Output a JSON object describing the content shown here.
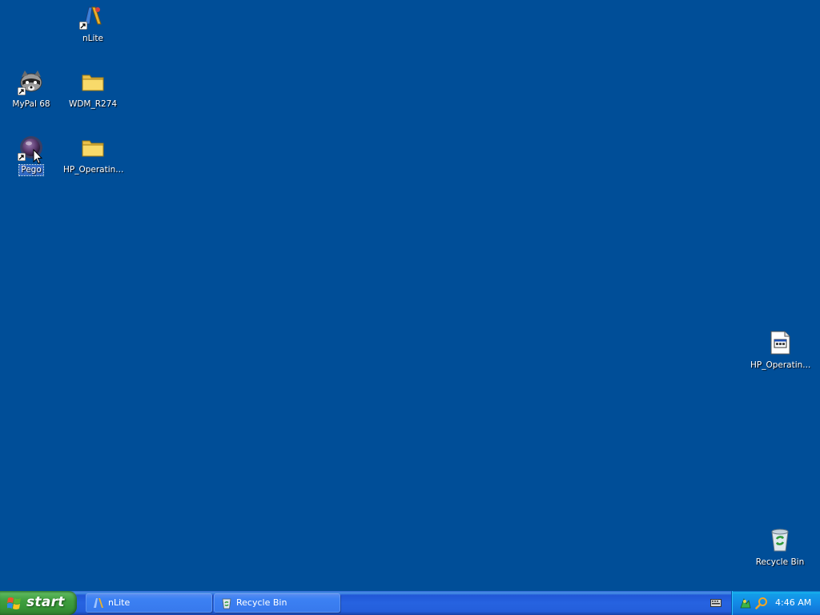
{
  "desktop": {
    "background_color": "#004e98",
    "icons": [
      {
        "label": "nLite",
        "icon": "nlite-icon",
        "shortcut": true
      },
      {
        "label": "MyPal 68",
        "icon": "raccoon-icon",
        "shortcut": true
      },
      {
        "label": "WDM_R274",
        "icon": "folder-icon",
        "shortcut": false
      },
      {
        "label": "Pego",
        "icon": "pego-ball-icon",
        "shortcut": true,
        "selected": true
      },
      {
        "label": "HP_Operatin...",
        "icon": "folder-icon",
        "shortcut": false
      },
      {
        "label": "HP_Operatin...",
        "icon": "application-window-icon",
        "shortcut": false
      },
      {
        "label": "Recycle Bin",
        "icon": "recycle-bin-icon",
        "shortcut": false
      }
    ]
  },
  "taskbar": {
    "start_label": "start",
    "buttons": [
      {
        "label": "nLite",
        "icon": "nlite-icon"
      },
      {
        "label": "Recycle Bin",
        "icon": "recycle-bin-icon"
      }
    ],
    "tray": {
      "icons": [
        "network-icon",
        "search-icon"
      ],
      "clock": "4:46 AM"
    },
    "colors": {
      "start_green": "#3f9f3f",
      "taskbar_blue": "#245edb",
      "tray_blue": "#138ae6"
    }
  }
}
